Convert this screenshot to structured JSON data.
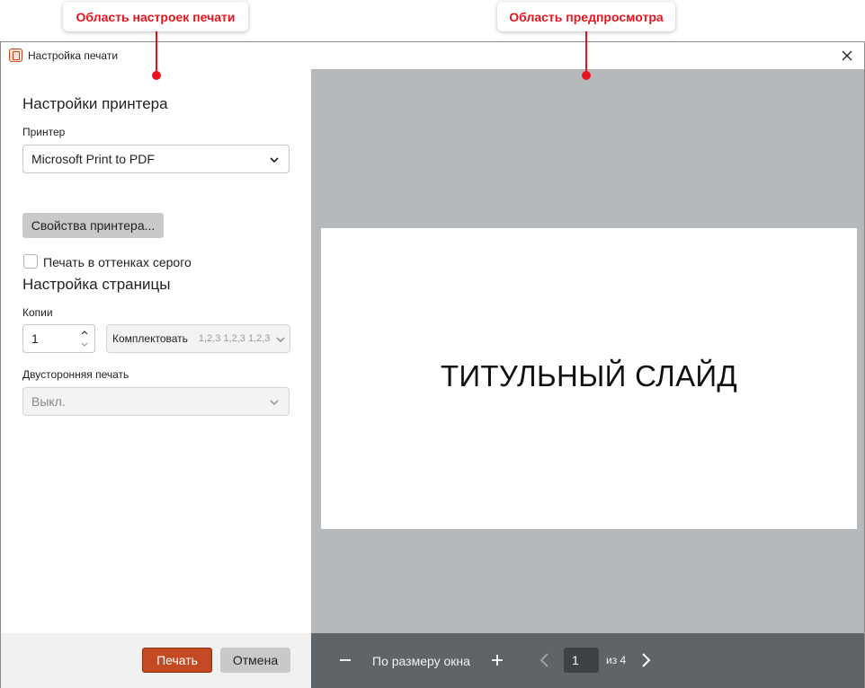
{
  "callouts": {
    "settings_area": "Область настроек печати",
    "preview_area": "Область предпросмотра"
  },
  "window": {
    "title": "Настройка печати"
  },
  "printer_settings": {
    "section_title": "Настройки принтера",
    "printer_label": "Принтер",
    "printer_value": "Microsoft Print to PDF",
    "properties_button": "Свойства принтера...",
    "grayscale_label": "Печать в оттенках серого",
    "grayscale_checked": false
  },
  "page_settings": {
    "section_title": "Настройка страницы",
    "copies_label": "Копии",
    "copies_value": "1",
    "collate_label": "Комплектовать",
    "collate_sequence": "1,2,3 1,2,3 1,2,3",
    "duplex_label": "Двусторонняя печать",
    "duplex_value": "Выкл."
  },
  "actions": {
    "print_button": "Печать",
    "cancel_button": "Отмена"
  },
  "preview": {
    "slide_title": "ТИТУЛЬНЫЙ СЛАЙД",
    "zoom_label": "По размеру окна",
    "current_page": "1",
    "page_total": "из 4"
  },
  "colors": {
    "accent": "#c34a23",
    "callout": "#e8141d",
    "preview_bg": "#b6b9bc",
    "preview_footer": "#5f6468"
  }
}
